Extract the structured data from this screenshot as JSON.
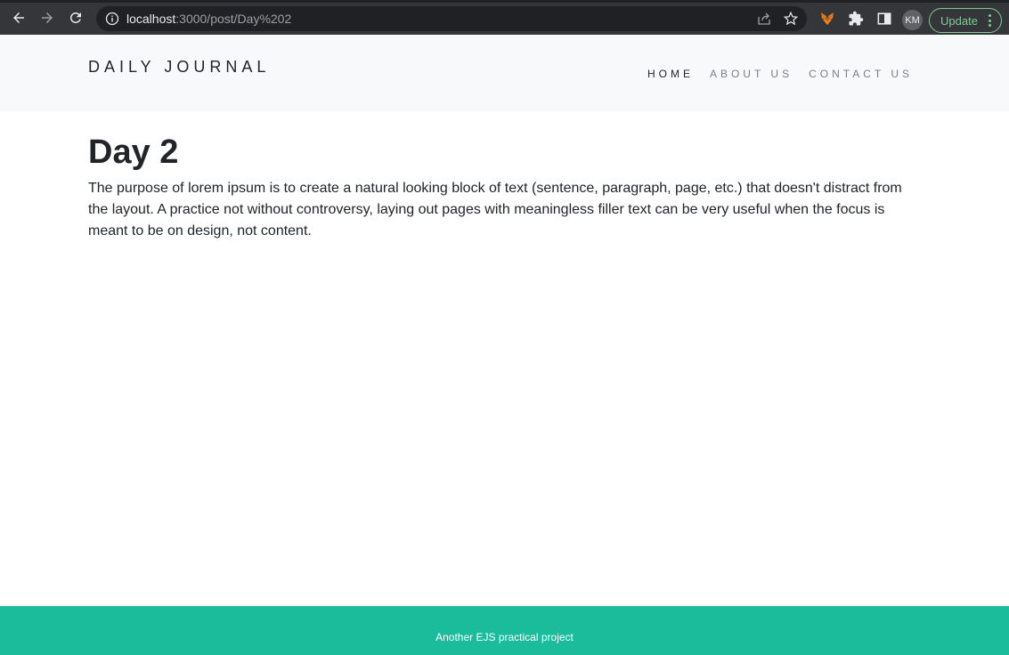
{
  "browser": {
    "url_host": "localhost",
    "url_path": ":3000/post/Day%202",
    "avatar_initials": "KM",
    "update_label": "Update"
  },
  "navbar": {
    "brand": "DAILY JOURNAL",
    "links": [
      {
        "label": "HOME",
        "active": true
      },
      {
        "label": "ABOUT US",
        "active": false
      },
      {
        "label": "CONTACT US",
        "active": false
      }
    ]
  },
  "post": {
    "title": "Day 2",
    "body": "The purpose of lorem ipsum is to create a natural looking block of text (sentence, paragraph, page, etc.) that doesn't distract from the layout. A practice not without controversy, laying out pages with meaningless filler text can be very useful when the focus is meant to be on design, not content."
  },
  "footer": {
    "text": "Another EJS practical project"
  },
  "colors": {
    "footer_bg": "#1abc9c",
    "navbar_bg": "#f8f9fa",
    "update_accent": "#81c995"
  }
}
